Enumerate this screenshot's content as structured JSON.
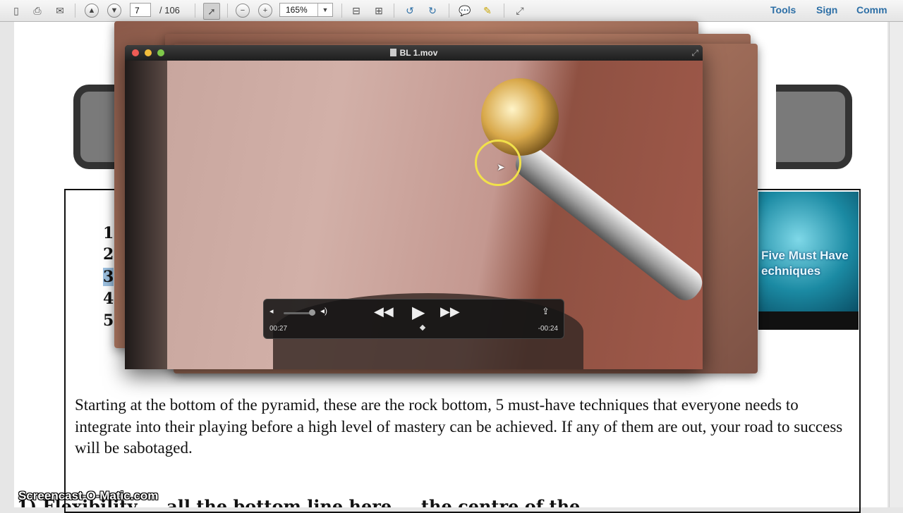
{
  "toolbar": {
    "page_current": "7",
    "page_total": "/ 106",
    "zoom": "165%",
    "links": [
      "Tools",
      "Sign",
      "Comm"
    ]
  },
  "document": {
    "list_numbers": [
      "1",
      "2",
      "3",
      "4",
      "5"
    ],
    "thumbnail_text": "Five Must Have\nechniques",
    "paragraph": "Starting at the bottom of the pyramid, these are the rock bottom, 5 must-have techniques that everyone needs to integrate into their playing before a high level of mastery can be achieved. If any of them are out, your road to success will be sabotaged.",
    "cut_line": "1) Flexibility ... all the bottom line here ... the centre of the"
  },
  "video": {
    "title": "BL 1.mov",
    "elapsed": "00:27",
    "remaining": "-00:24",
    "progress_fraction": 0.53
  },
  "watermark": "Screencast-O-Matic.com",
  "colors": {
    "accent_link": "#2d6fa6",
    "selection": "#9cc0e0",
    "cursor_ring": "#f1e14a"
  }
}
